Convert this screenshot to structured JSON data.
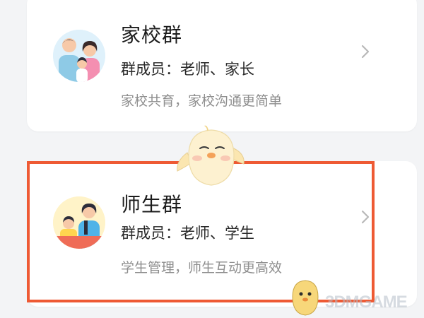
{
  "groups": [
    {
      "title": "家校群",
      "members": "群成员：老师、家长",
      "description": "家校共育，家校沟通更简单"
    },
    {
      "title": "师生群",
      "members": "群成员：老师、学生",
      "description": "学生管理，师生互动更高效"
    }
  ],
  "highlight_color": "#ee5a34",
  "watermark_text": "3DMGAME",
  "icons": {
    "family_avatar": "family-illustration-icon",
    "class_avatar": "teacher-student-illustration-icon",
    "chevron": "chevron-right-icon",
    "mascot": "chick-mascot-icon"
  }
}
